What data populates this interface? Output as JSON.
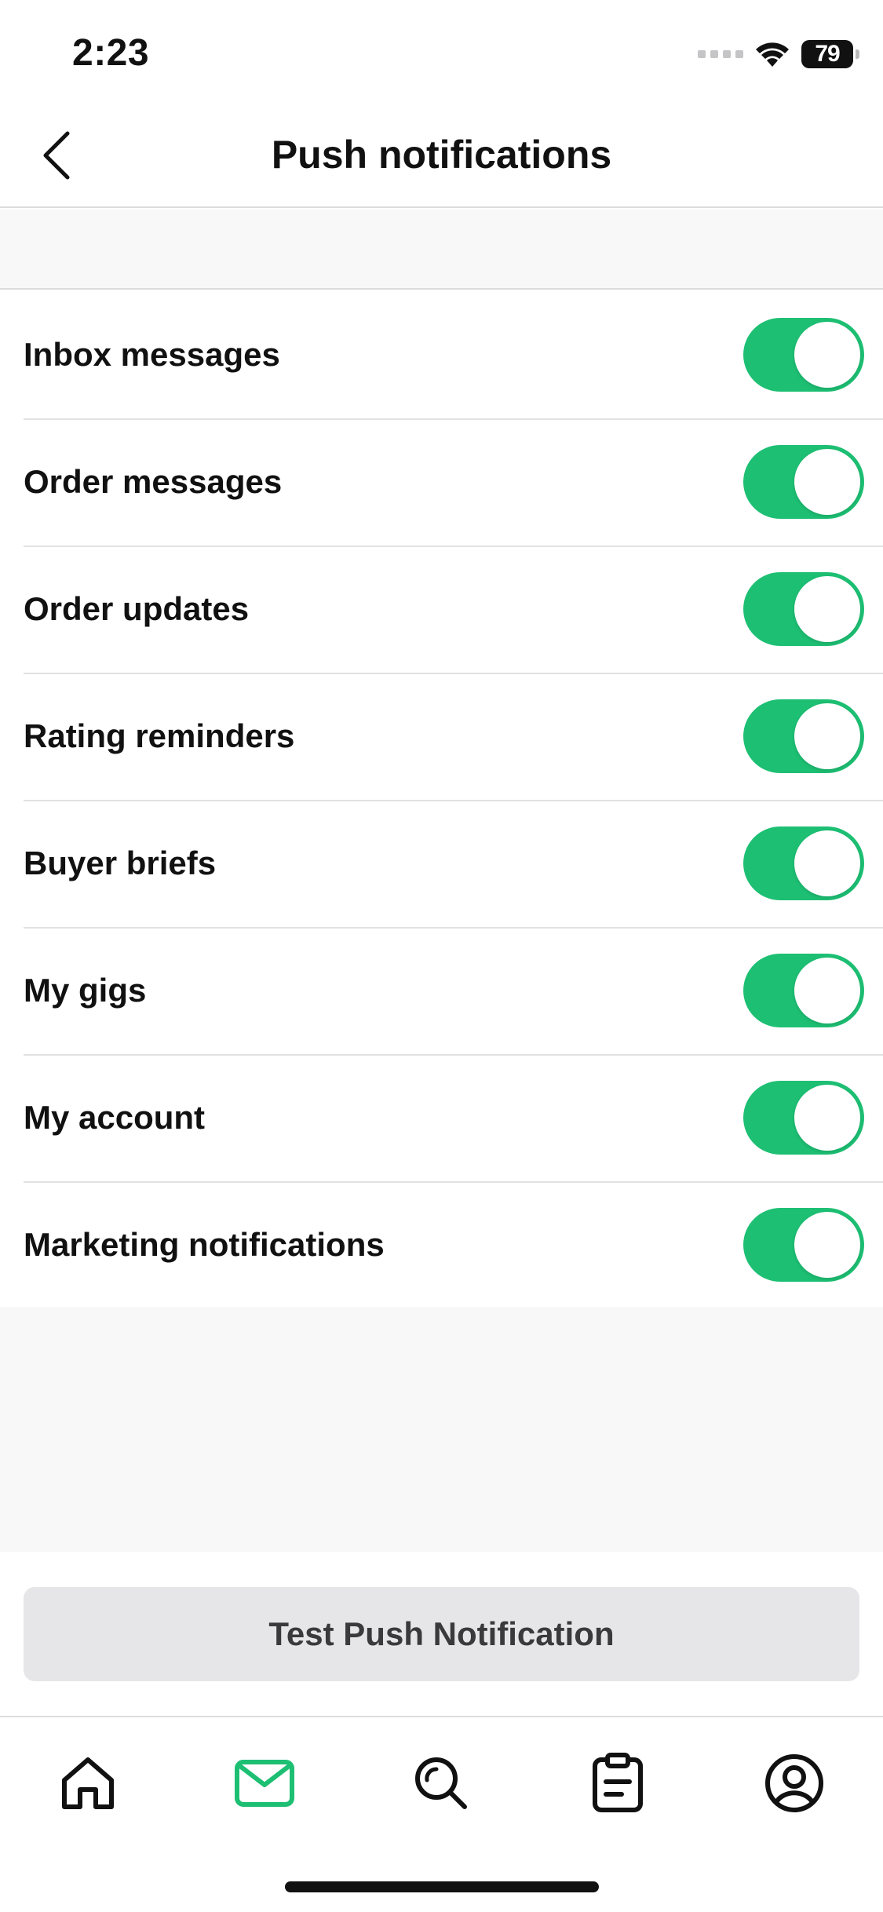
{
  "status_bar": {
    "time": "2:23",
    "battery": "79"
  },
  "header": {
    "title": "Push notifications",
    "back_icon": "chevron-left-icon"
  },
  "settings": [
    {
      "label": "Inbox messages",
      "enabled": true
    },
    {
      "label": "Order messages",
      "enabled": true
    },
    {
      "label": "Order updates",
      "enabled": true
    },
    {
      "label": "Rating reminders",
      "enabled": true
    },
    {
      "label": "Buyer briefs",
      "enabled": true
    },
    {
      "label": "My gigs",
      "enabled": true
    },
    {
      "label": "My account",
      "enabled": true
    },
    {
      "label": "Marketing notifications",
      "enabled": true
    }
  ],
  "test_button": {
    "label": "Test Push Notification"
  },
  "tab_bar": {
    "tabs": [
      {
        "icon": "home-icon",
        "active": false
      },
      {
        "icon": "inbox-icon",
        "active": true
      },
      {
        "icon": "search-icon",
        "active": false
      },
      {
        "icon": "orders-icon",
        "active": false
      },
      {
        "icon": "profile-icon",
        "active": false
      }
    ]
  },
  "colors": {
    "accent": "#1dbf73",
    "text": "#111111",
    "muted_background": "#f8f8f8",
    "button_background": "#e6e6e8"
  }
}
